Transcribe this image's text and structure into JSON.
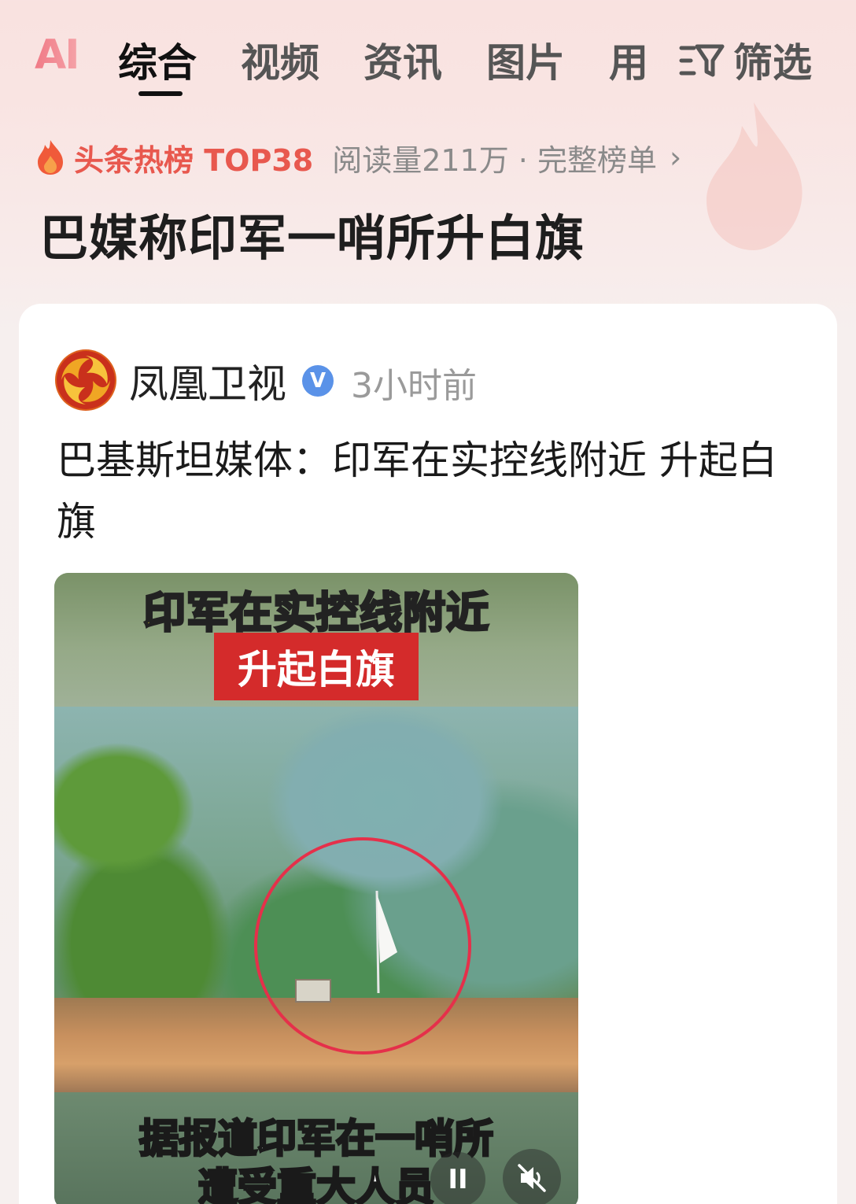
{
  "tabs": {
    "ai": "AI",
    "items": [
      "综合",
      "视频",
      "资讯",
      "图片",
      "用"
    ],
    "active_index": 0,
    "filter_label": "筛选"
  },
  "hot": {
    "rank_label": "头条热榜 TOP38",
    "reads": "阅读量211万 · 完整榜单",
    "chevron": "›"
  },
  "topic_title": "巴媒称印军一哨所升白旗",
  "card": {
    "source": "凤凰卫视",
    "verified_badge": "V",
    "time": "3小时前",
    "headline": "巴基斯坦媒体：印军在实控线附近 升起白旗",
    "video": {
      "caption_top": "印军在实控线附近",
      "caption_red": "升起白旗",
      "caption_bottom_1": "据报道印军在一哨所",
      "caption_bottom_2": "遭受重大人员",
      "pause_symbol": "II"
    }
  },
  "colors": {
    "accent_red": "#e8584e",
    "verified_blue": "#5a92e8",
    "caption_yellow": "#f7e23a",
    "caption_red_bg": "#d42b2b"
  }
}
